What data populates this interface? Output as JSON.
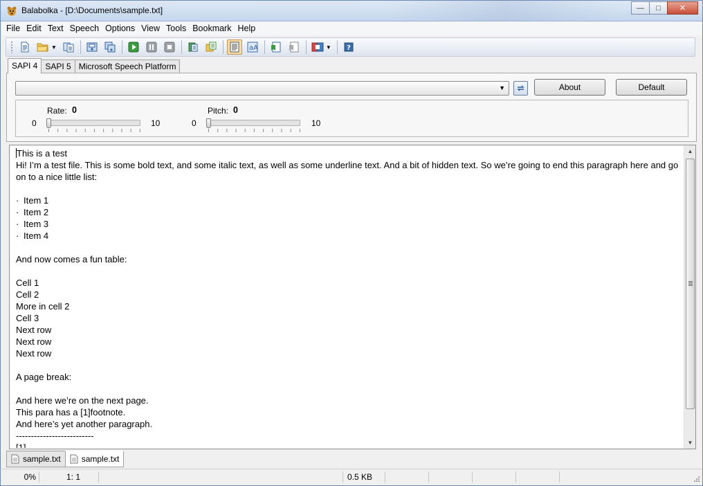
{
  "window": {
    "title": "Balabolka - [D:\\Documents\\sample.txt]",
    "minimize_glyph": "—",
    "maximize_glyph": "□",
    "close_glyph": "✕"
  },
  "menu": [
    "File",
    "Edit",
    "Text",
    "Speech",
    "Options",
    "View",
    "Tools",
    "Bookmark",
    "Help"
  ],
  "toolbar": {
    "icons": [
      "new-document-icon",
      "open-folder-icon",
      "open-dropdown-icon",
      "save-icon",
      "save-audio-icon",
      "save-audio-split-icon",
      "play-icon",
      "pause-icon",
      "stop-icon",
      "read-clipboard-icon",
      "read-files-icon",
      "text-format-icon",
      "font-icon",
      "bookmark-add-icon",
      "bookmark-remove-icon",
      "voice-icon",
      "voice-dropdown-icon",
      "help-icon"
    ]
  },
  "engine_tabs": [
    "SAPI 4",
    "SAPI 5",
    "Microsoft Speech Platform"
  ],
  "voice_panel": {
    "selected_voice": "",
    "about_label": "About",
    "default_label": "Default"
  },
  "rate": {
    "label": "Rate:",
    "value": "0",
    "min": "0",
    "max": "10"
  },
  "pitch": {
    "label": "Pitch:",
    "value": "0",
    "min": "0",
    "max": "10"
  },
  "editor": {
    "lines": [
      "This is a test",
      "Hi! I’m a test file. This is some bold text, and some italic text, as well as some underline text. And a bit of hidden text. So we’re going to end this paragraph here and go on to a nice little list:",
      "",
      "Item 1",
      "Item 2",
      "Item 3",
      "Item 4",
      "",
      "And now comes a fun table:",
      "",
      "Cell 1",
      "Cell 2",
      "More in cell 2",
      "Cell 3",
      "Next row",
      "Next row",
      "Next row",
      "",
      "A page break:",
      "",
      "And here we’re on the next page.",
      "This para has a [1]footnote.",
      "And here’s yet another paragraph.",
      "--------------------------",
      "[1]"
    ],
    "bullet": "·"
  },
  "doc_tabs": [
    "sample.txt",
    "sample.txt"
  ],
  "status": {
    "progress": "0%",
    "position": "1:  1",
    "size": "0.5 KB"
  }
}
